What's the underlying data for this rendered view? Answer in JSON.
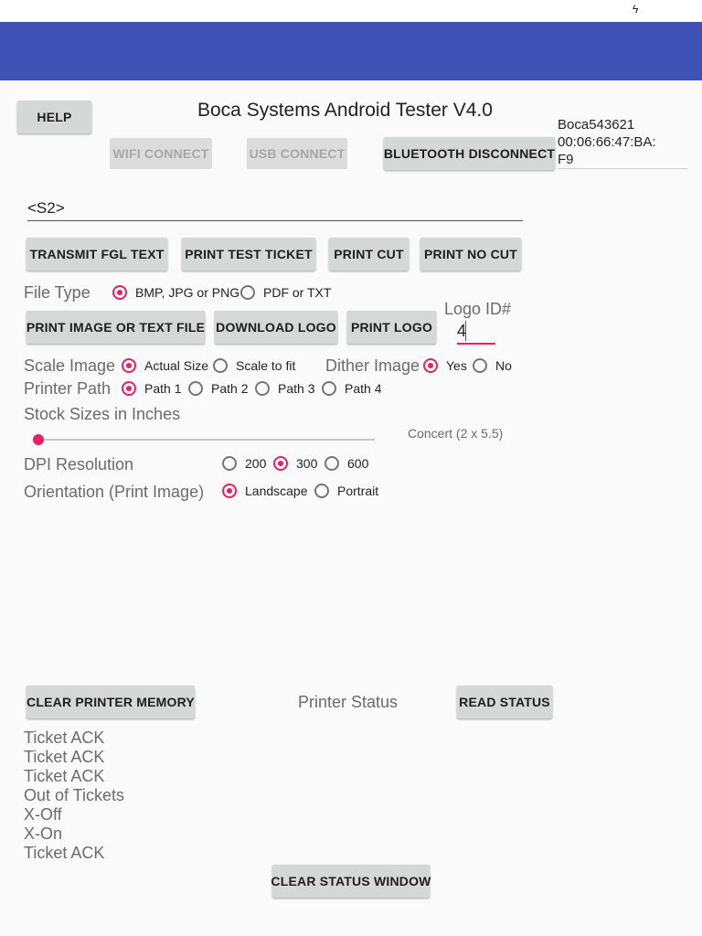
{
  "app": {
    "title": "Boca Systems Android Tester V4.0",
    "accent": "#3f51b5",
    "radio_color": "#e91e63"
  },
  "device": {
    "name": "Boca543621",
    "mac_line1": "00:06:66:47:BA:",
    "mac_line2": "F9"
  },
  "buttons": {
    "help": "HELP",
    "wifi_connect": "WIFI CONNECT",
    "usb_connect": "USB CONNECT",
    "bluetooth_disconnect": "BLUETOOTH DISCONNECT",
    "transmit_fgl_text": "TRANSMIT FGL TEXT",
    "print_test_ticket": "PRINT TEST TICKET",
    "print_cut": "PRINT CUT",
    "print_no_cut": "PRINT NO CUT",
    "print_image_or_text_file": "PRINT IMAGE OR TEXT FILE",
    "download_logo": "DOWNLOAD LOGO",
    "print_logo": "PRINT LOGO",
    "clear_printer_memory": "CLEAR PRINTER MEMORY",
    "read_status": "READ STATUS",
    "clear_status_window": "CLEAR STATUS WINDOW"
  },
  "fgl_input": {
    "value": "<S2>"
  },
  "file_type": {
    "label": "File Type",
    "options": [
      "BMP, JPG or PNG",
      "PDF or TXT"
    ],
    "selected": "BMP, JPG or PNG"
  },
  "logo_id": {
    "label": "Logo ID#",
    "value": "4"
  },
  "scale_image": {
    "label": "Scale Image",
    "options": [
      "Actual Size",
      "Scale to fit"
    ],
    "selected": "Actual Size"
  },
  "dither_image": {
    "label": "Dither Image",
    "options": [
      "Yes",
      "No"
    ],
    "selected": "Yes"
  },
  "printer_path": {
    "label": "Printer Path",
    "options": [
      "Path 1",
      "Path 2",
      "Path 3",
      "Path 4"
    ],
    "selected": "Path 1"
  },
  "stock_sizes": {
    "label": "Stock Sizes in Inches",
    "value_text": "Concert (2 x 5.5)",
    "slider_fraction": 0
  },
  "dpi": {
    "label": "DPI Resolution",
    "options": [
      "200",
      "300",
      "600"
    ],
    "selected": "300"
  },
  "orientation": {
    "label": "Orientation (Print Image)",
    "options": [
      "Landscape",
      "Portrait"
    ],
    "selected": "Landscape"
  },
  "printer_status": {
    "label": "Printer Status",
    "log": [
      "Ticket ACK",
      "Ticket ACK",
      "Ticket ACK",
      "Out of Tickets",
      "X-Off",
      "X-On",
      "Ticket ACK"
    ]
  }
}
